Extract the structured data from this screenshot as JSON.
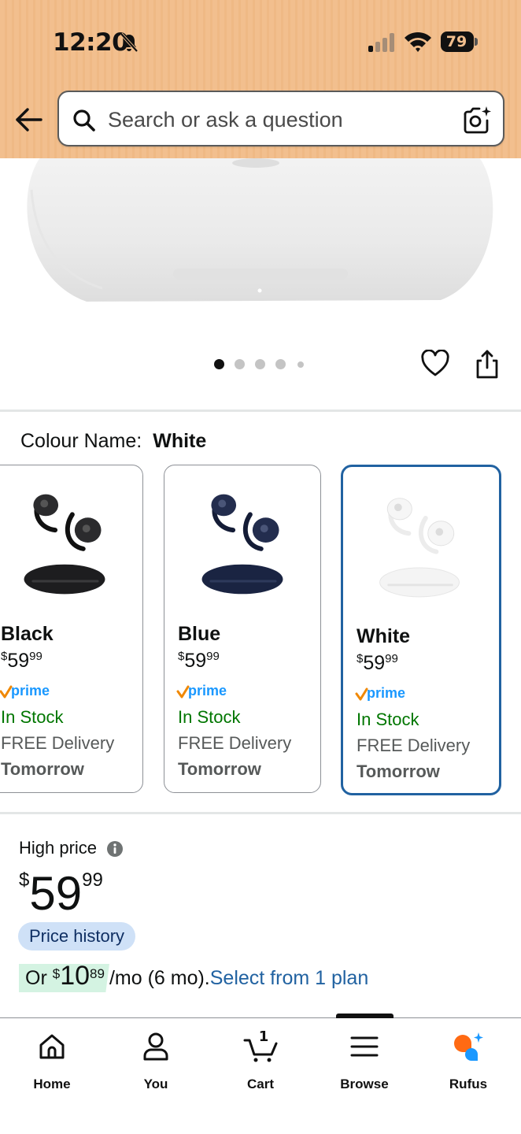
{
  "status_bar": {
    "time": "12:20",
    "battery": "79"
  },
  "search": {
    "placeholder": "Search or ask a question"
  },
  "colour": {
    "label": "Colour Name:",
    "value": "White"
  },
  "variants": [
    {
      "name": "Black",
      "currency": "$",
      "whole": "59",
      "fraction": "99",
      "prime": "prime",
      "stock": "In Stock",
      "delivery": "FREE Delivery",
      "delivery_day": "Tomorrow"
    },
    {
      "name": "Blue",
      "currency": "$",
      "whole": "59",
      "fraction": "99",
      "prime": "prime",
      "stock": "In Stock",
      "delivery": "FREE Delivery",
      "delivery_day": "Tomorrow"
    },
    {
      "name": "White",
      "currency": "$",
      "whole": "59",
      "fraction": "99",
      "prime": "prime",
      "stock": "In Stock",
      "delivery": "FREE Delivery",
      "delivery_day": "Tomorrow"
    }
  ],
  "price": {
    "badge": "High price",
    "currency": "$",
    "whole": "59",
    "fraction": "99",
    "history_label": "Price history"
  },
  "installment": {
    "prefix": "Or",
    "currency": "$",
    "whole": "10",
    "fraction": "89",
    "suffix": "/mo (6 mo).",
    "link": "Select from 1 plan"
  },
  "nav": {
    "home": "Home",
    "you": "You",
    "cart": "Cart",
    "cart_count": "1",
    "browse": "Browse",
    "rufus": "Rufus"
  },
  "colors": {
    "header_bg": "#f2bf8e",
    "selected_border": "#2162a1",
    "in_stock": "#007600",
    "link": "#2162a1",
    "prime_check": "#f08804",
    "prime_text": "#1a98ff"
  }
}
